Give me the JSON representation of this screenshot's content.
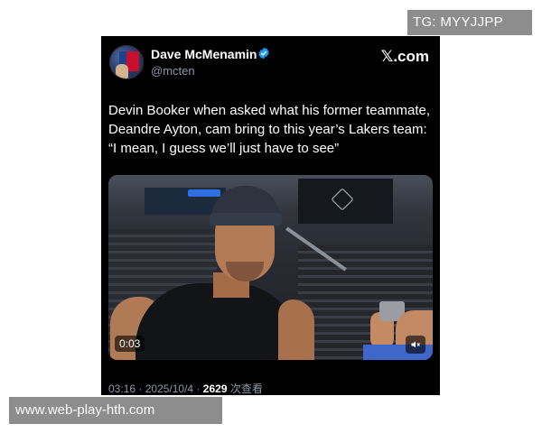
{
  "watermarks": {
    "top": "TG: MYYJJPP",
    "bottom": "www.web-play-hth.com"
  },
  "tweet": {
    "author_name": "Dave McMenamin",
    "handle": "@mcten",
    "platform_logo": "𝕏.com",
    "text": "Devin Booker when asked what his former teammate, Deandre Ayton, cam bring to this year’s Lakers team: “I mean, I guess we’ll just have to see”",
    "video": {
      "timestamp": "0:03",
      "mute_icon": "speaker-muted-icon"
    },
    "meta": {
      "time": "03:16",
      "date": "2025/10/4",
      "views": "2629",
      "views_label": "次查看",
      "separator": "·"
    }
  },
  "colors": {
    "card_bg": "#000000",
    "verified": "#1d9bf0",
    "secondary_text": "#8b98a5",
    "watermark_bg": "#8d8d8d"
  }
}
